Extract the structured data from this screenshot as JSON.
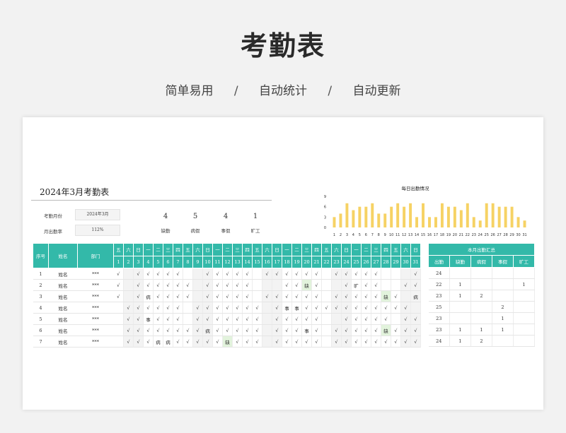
{
  "header": {
    "title": "考勤表",
    "tags": [
      "简单易用",
      "自动统计",
      "自动更新"
    ],
    "separator": "/"
  },
  "sheet": {
    "title": "2024年3月考勤表",
    "month_label": "考勤月份",
    "month_value": "2024年3月",
    "rate_label": "月出勤率",
    "rate_value": "112%",
    "stats": [
      {
        "value": "4",
        "label": "缺勤"
      },
      {
        "value": "5",
        "label": "病假"
      },
      {
        "value": "4",
        "label": "事假"
      },
      {
        "value": "1",
        "label": "旷工"
      }
    ]
  },
  "chart_data": {
    "type": "bar",
    "title": "每日出勤情况",
    "categories": [
      "1",
      "2",
      "3",
      "4",
      "5",
      "6",
      "7",
      "8",
      "9",
      "10",
      "11",
      "12",
      "13",
      "14",
      "15",
      "16",
      "17",
      "18",
      "19",
      "20",
      "21",
      "22",
      "23",
      "24",
      "25",
      "26",
      "27",
      "28",
      "29",
      "30",
      "31"
    ],
    "values": [
      3,
      4,
      7,
      5,
      6,
      6,
      7,
      4,
      4,
      6,
      7,
      6,
      7,
      3,
      7,
      3,
      3,
      7,
      6,
      6,
      5,
      7,
      3,
      2,
      7,
      7,
      6,
      6,
      6,
      3,
      2,
      6
    ],
    "ylim": [
      0,
      9
    ],
    "yticks": [
      "0",
      "3",
      "6",
      "9"
    ],
    "color": "#f6d264",
    "grid": false
  },
  "table": {
    "col_index": "序号",
    "col_name": "姓名",
    "col_dept": "部门",
    "weekdays": [
      "五",
      "六",
      "日",
      "一",
      "二",
      "三",
      "四",
      "五",
      "六",
      "日",
      "一",
      "二",
      "三",
      "四",
      "五",
      "六",
      "日",
      "一",
      "二",
      "三",
      "四",
      "五",
      "六",
      "日",
      "一",
      "二",
      "三",
      "四",
      "五",
      "六",
      "日"
    ],
    "days": [
      "1",
      "2",
      "3",
      "4",
      "5",
      "6",
      "7",
      "8",
      "9",
      "10",
      "11",
      "12",
      "13",
      "14",
      "15",
      "16",
      "17",
      "18",
      "19",
      "20",
      "21",
      "22",
      "23",
      "24",
      "25",
      "26",
      "27",
      "28",
      "29",
      "30",
      "31"
    ],
    "rows": [
      {
        "index": "1",
        "name": "姓名",
        "dept": "***",
        "cells": [
          "√",
          "",
          "√",
          "√",
          "√",
          "√",
          "√",
          "",
          "",
          "√",
          "√",
          "√",
          "√",
          "√",
          "",
          "√",
          "√",
          "√",
          "√",
          "√",
          "√",
          "",
          "√",
          "√",
          "√",
          "√",
          "√",
          "",
          "",
          "",
          "√"
        ]
      },
      {
        "index": "2",
        "name": "姓名",
        "dept": "***",
        "cells": [
          "√",
          "",
          "√",
          "√",
          "√",
          "√",
          "√",
          "√",
          "",
          "√",
          "√",
          "√",
          "√",
          "√",
          "",
          "",
          "",
          "√",
          "√",
          "缺",
          "√",
          "",
          "",
          "√",
          "旷",
          "√",
          "√",
          "",
          "",
          "√",
          "√"
        ]
      },
      {
        "index": "3",
        "name": "姓名",
        "dept": "***",
        "cells": [
          "√",
          "",
          "√",
          "病",
          "√",
          "√",
          "√",
          "√",
          "",
          "√",
          "√",
          "√",
          "√",
          "√",
          "",
          "√",
          "√",
          "√",
          "√",
          "√",
          "√",
          "",
          "√",
          "√",
          "√",
          "√",
          "√",
          "缺",
          "√",
          "",
          "病"
        ]
      },
      {
        "index": "4",
        "name": "姓名",
        "dept": "***",
        "cells": [
          "",
          "√",
          "√",
          "√",
          "√",
          "√",
          "√",
          "",
          "√",
          "√",
          "√",
          "√",
          "√",
          "√",
          "√",
          "",
          "√",
          "事",
          "事",
          "√",
          "√",
          "√",
          "√",
          "√",
          "√",
          "√",
          "√",
          "√",
          "√",
          "√",
          ""
        ]
      },
      {
        "index": "5",
        "name": "姓名",
        "dept": "***",
        "cells": [
          "",
          "√",
          "√",
          "事",
          "√",
          "√",
          "√",
          "",
          "√",
          "√",
          "√",
          "√",
          "√",
          "√",
          "√",
          "",
          "√",
          "√",
          "√",
          "√",
          "√",
          "",
          "",
          "√",
          "√",
          "√",
          "√",
          "√",
          "",
          "√",
          "√"
        ]
      },
      {
        "index": "6",
        "name": "姓名",
        "dept": "***",
        "cells": [
          "",
          "√",
          "√",
          "√",
          "√",
          "√",
          "√",
          "√",
          "√",
          "病",
          "√",
          "√",
          "√",
          "√",
          "√",
          "",
          "√",
          "√",
          "√",
          "事",
          "√",
          "",
          "√",
          "√",
          "√",
          "√",
          "√",
          "缺",
          "√",
          "√",
          "√"
        ]
      },
      {
        "index": "7",
        "name": "姓名",
        "dept": "***",
        "cells": [
          "",
          "√",
          "√",
          "√",
          "病",
          "病",
          "√",
          "√",
          "√",
          "√",
          "√",
          "缺",
          "√",
          "√",
          "√",
          "",
          "√",
          "√",
          "√",
          "√",
          "√",
          "",
          "√",
          "√",
          "√",
          "√",
          "√",
          "√",
          "√",
          "√",
          "√"
        ]
      }
    ]
  },
  "summary": {
    "title": "本月出勤汇总",
    "headers": [
      "出勤",
      "缺勤",
      "病假",
      "事假",
      "旷工"
    ],
    "rows": [
      [
        "24",
        "",
        "",
        "",
        ""
      ],
      [
        "22",
        "1",
        "",
        "",
        "1"
      ],
      [
        "23",
        "1",
        "2",
        "",
        ""
      ],
      [
        "25",
        "",
        "",
        "2",
        ""
      ],
      [
        "23",
        "",
        "",
        "1",
        ""
      ],
      [
        "23",
        "1",
        "1",
        "1",
        ""
      ],
      [
        "24",
        "1",
        "2",
        "",
        ""
      ]
    ]
  }
}
